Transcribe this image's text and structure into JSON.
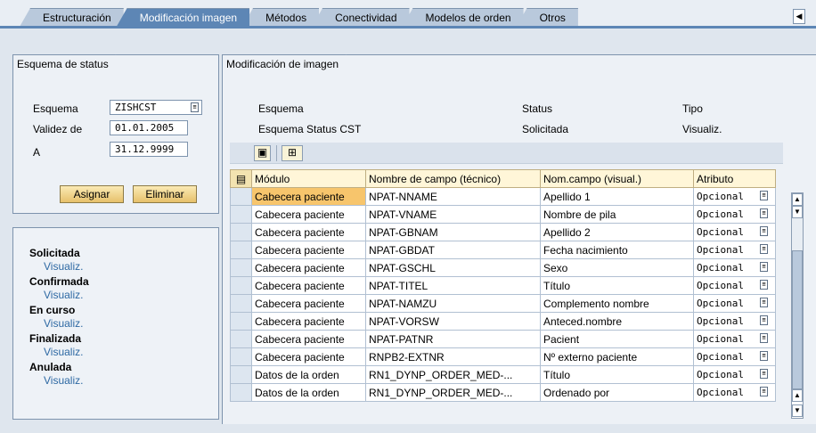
{
  "tabs": [
    {
      "label": "Estructuración",
      "active": false
    },
    {
      "label": "Modificación imagen",
      "active": true
    },
    {
      "label": "Métodos",
      "active": false
    },
    {
      "label": "Conectividad",
      "active": false
    },
    {
      "label": "Modelos de orden",
      "active": false
    },
    {
      "label": "Otros",
      "active": false
    }
  ],
  "status_schema": {
    "title": "Esquema de status",
    "fields": [
      {
        "label": "Esquema",
        "value": "ZISHCST",
        "has_f4": true
      },
      {
        "label": "Validez de",
        "value": "01.01.2005",
        "has_f4": false
      },
      {
        "label": "A",
        "value": "31.12.9999",
        "has_f4": false
      }
    ],
    "assign_button": "Asignar",
    "delete_button": "Eliminar"
  },
  "status_list": [
    {
      "status": "Solicitada",
      "type": "Visualiz."
    },
    {
      "status": "Confirmada",
      "type": "Visualiz."
    },
    {
      "status": "En curso",
      "type": "Visualiz."
    },
    {
      "status": "Finalizada",
      "type": "Visualiz."
    },
    {
      "status": "Anulada",
      "type": "Visualiz."
    }
  ],
  "image_mod": {
    "title": "Modificación de imagen",
    "header_labels": {
      "schema": "Esquema",
      "status": "Status",
      "type": "Tipo"
    },
    "header_values": {
      "schema": "Esquema Status CST",
      "status": "Solicitada",
      "type": "Visualiz."
    },
    "toolbar_icons": [
      "binoculars-icon",
      "layout-icon"
    ],
    "columns": [
      "Módulo",
      "Nombre de campo (técnico)",
      "Nom.campo (visual.)",
      "Atributo"
    ],
    "rows": [
      [
        "Cabecera paciente",
        "NPAT-NNAME",
        "Apellido 1",
        "Opcional"
      ],
      [
        "Cabecera paciente",
        "NPAT-VNAME",
        "Nombre de pila",
        "Opcional"
      ],
      [
        "Cabecera paciente",
        "NPAT-GBNAM",
        "Apellido 2",
        "Opcional"
      ],
      [
        "Cabecera paciente",
        "NPAT-GBDAT",
        "Fecha nacimiento",
        "Opcional"
      ],
      [
        "Cabecera paciente",
        "NPAT-GSCHL",
        "Sexo",
        "Opcional"
      ],
      [
        "Cabecera paciente",
        "NPAT-TITEL",
        "Título",
        "Opcional"
      ],
      [
        "Cabecera paciente",
        "NPAT-NAMZU",
        "Complemento nombre",
        "Opcional"
      ],
      [
        "Cabecera paciente",
        "NPAT-VORSW",
        "Anteced.nombre",
        "Opcional"
      ],
      [
        "Cabecera paciente",
        "NPAT-PATNR",
        "Pacient",
        "Opcional"
      ],
      [
        "Cabecera paciente",
        "RNPB2-EXTNR",
        "Nº externo paciente",
        "Opcional"
      ],
      [
        "Datos de la orden",
        "RN1_DYNP_ORDER_MED-...",
        "Título",
        "Opcional"
      ],
      [
        "Datos de la orden",
        "RN1_DYNP_ORDER_MED-...",
        "Ordenado por",
        "Opcional"
      ]
    ]
  }
}
